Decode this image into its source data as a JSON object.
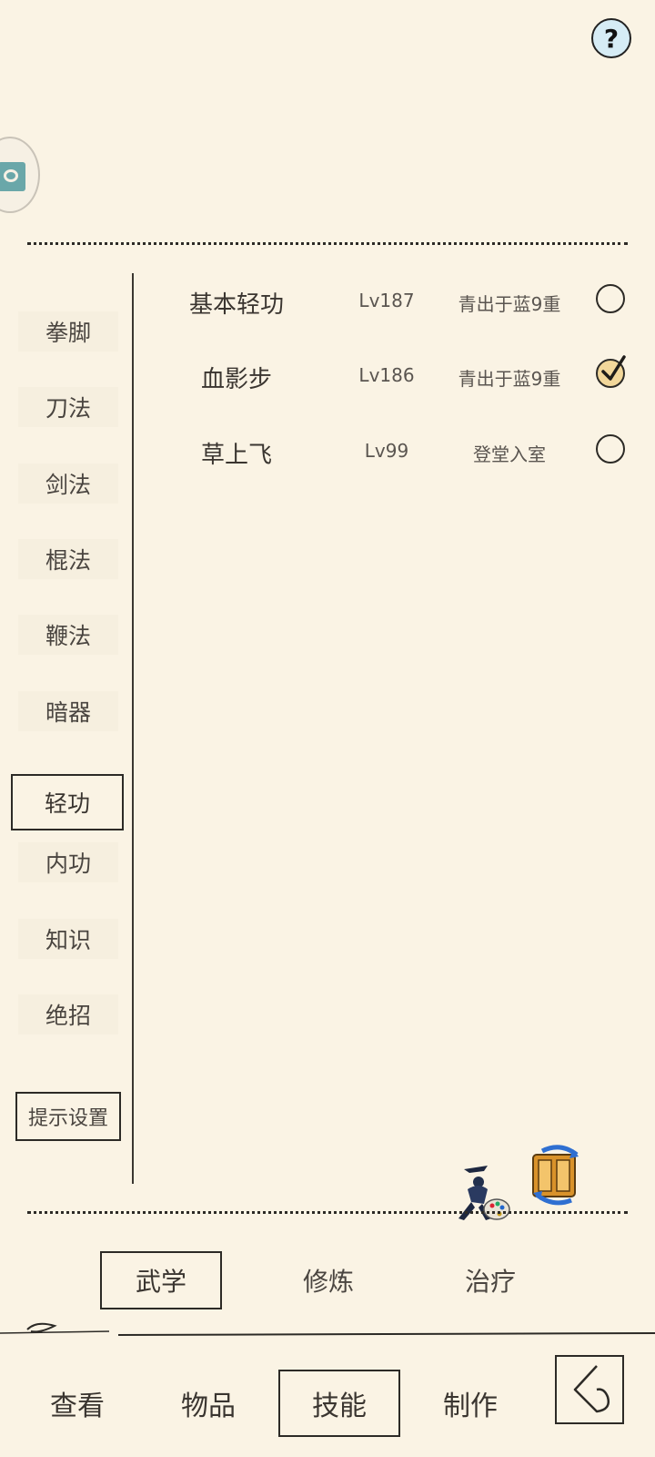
{
  "header": {
    "help_label": "?"
  },
  "categories": [
    {
      "label": "拳脚"
    },
    {
      "label": "刀法"
    },
    {
      "label": "剑法"
    },
    {
      "label": "棍法"
    },
    {
      "label": "鞭法"
    },
    {
      "label": "暗器"
    },
    {
      "label": "轻功",
      "active": true
    },
    {
      "label": "内功"
    },
    {
      "label": "知识"
    },
    {
      "label": "绝招"
    }
  ],
  "tips_settings_label": "提示设置",
  "skills": [
    {
      "name": "基本轻功",
      "level": "Lv187",
      "rank": "青出于蓝9重",
      "checked": false
    },
    {
      "name": "血影步",
      "level": "Lv186",
      "rank": "青出于蓝9重",
      "checked": true
    },
    {
      "name": "草上飞",
      "level": "Lv99",
      "rank": "登堂入室",
      "checked": false
    }
  ],
  "tools": {
    "icon1": "martial-artist-palette-icon",
    "icon2": "scroll-swap-icon"
  },
  "subtabs": [
    {
      "label": "武学",
      "active": true
    },
    {
      "label": "修炼"
    },
    {
      "label": "治疗"
    }
  ],
  "bottom_nav": [
    {
      "label": "查看"
    },
    {
      "label": "物品"
    },
    {
      "label": "技能",
      "active": true
    },
    {
      "label": "制作"
    }
  ],
  "colors": {
    "background": "#faf3e4",
    "ink": "#2c2a26",
    "checked_fill": "#f2d79a",
    "help_fill": "#d6ecf5"
  }
}
